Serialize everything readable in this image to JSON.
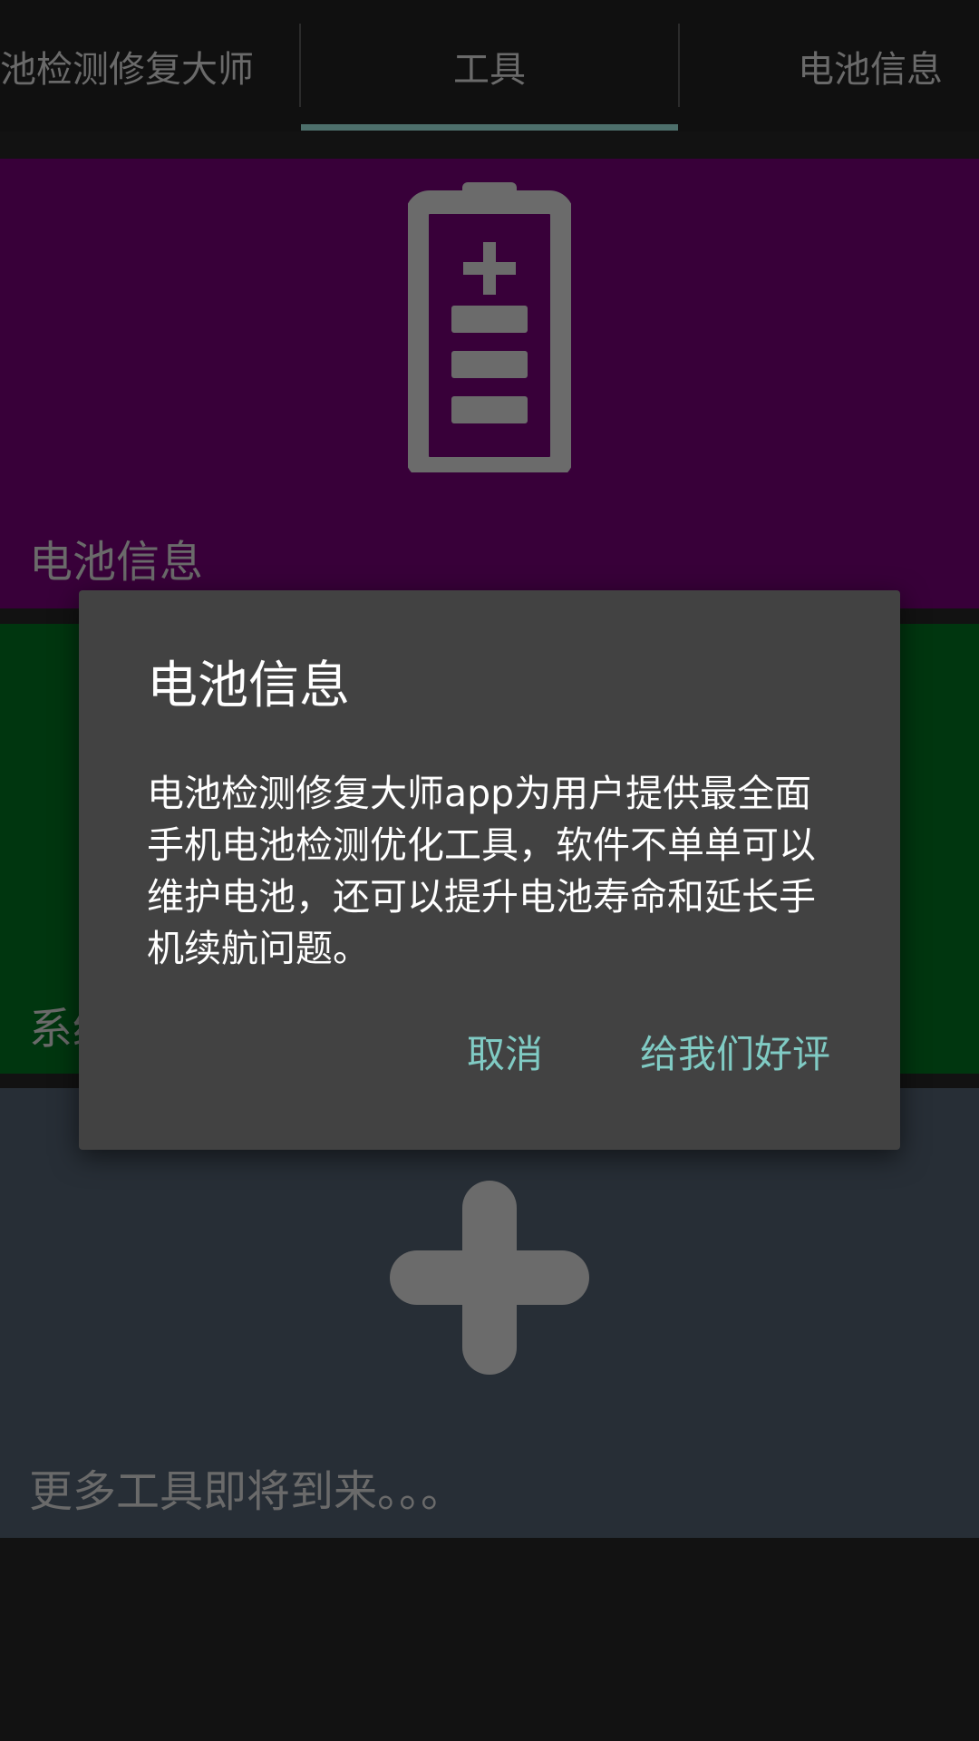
{
  "tabs": [
    {
      "label": "池检测修复大师"
    },
    {
      "label": "工具"
    },
    {
      "label": "电池信息"
    }
  ],
  "cards": {
    "battery": {
      "label": "电池信息",
      "icon": "battery-icon",
      "color": "#380039"
    },
    "system": {
      "label": "系统",
      "color": "#00360f"
    },
    "more": {
      "label": "更多工具即将到来。。。",
      "icon": "plus-icon",
      "color": "#272e36"
    }
  },
  "dialog": {
    "title": "电池信息",
    "message": "电池检测修复大师app为用户提供最全面手机电池检测优化工具，软件不单单可以维护电池，还可以提升电池寿命和延长手机续航问题。",
    "cancel_label": "取消",
    "rate_label": "给我们好评"
  },
  "colors": {
    "accent": "#80cbc4",
    "tab_indicator": "#4d6f6b",
    "dialog_bg": "#424242"
  }
}
